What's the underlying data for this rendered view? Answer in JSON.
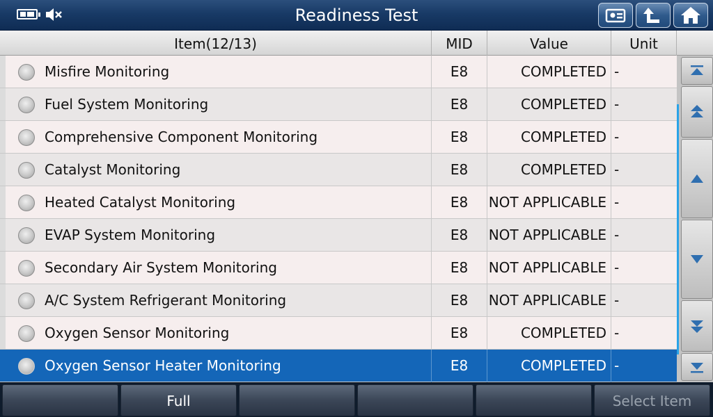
{
  "header": {
    "title": "Readiness Test",
    "status_icons": [
      "battery-icon",
      "speaker-muted-icon"
    ],
    "buttons": [
      "report-icon",
      "back-icon",
      "home-icon"
    ]
  },
  "table": {
    "columns": {
      "item": "Item(12/13)",
      "mid": "MID",
      "value": "Value",
      "unit": "Unit"
    },
    "rows": [
      {
        "item": "Misfire Monitoring",
        "mid": "E8",
        "value": "COMPLETED",
        "unit": "-"
      },
      {
        "item": "Fuel System Monitoring",
        "mid": "E8",
        "value": "COMPLETED",
        "unit": "-"
      },
      {
        "item": "Comprehensive Component Monitoring",
        "mid": "E8",
        "value": "COMPLETED",
        "unit": "-"
      },
      {
        "item": "Catalyst Monitoring",
        "mid": "E8",
        "value": "COMPLETED",
        "unit": "-"
      },
      {
        "item": "Heated Catalyst Monitoring",
        "mid": "E8",
        "value": "NOT APPLICABLE",
        "unit": "-"
      },
      {
        "item": "EVAP System Monitoring",
        "mid": "E8",
        "value": "NOT APPLICABLE",
        "unit": "-"
      },
      {
        "item": "Secondary Air System Monitoring",
        "mid": "E8",
        "value": "NOT APPLICABLE",
        "unit": "-"
      },
      {
        "item": "A/C System Refrigerant Monitoring",
        "mid": "E8",
        "value": "NOT APPLICABLE",
        "unit": "-"
      },
      {
        "item": "Oxygen Sensor Monitoring",
        "mid": "E8",
        "value": "COMPLETED",
        "unit": "-"
      },
      {
        "item": "Oxygen Sensor Heater Monitoring",
        "mid": "E8",
        "value": "COMPLETED",
        "unit": "-"
      }
    ],
    "selected_row": 9
  },
  "scroll": {
    "buttons": [
      "scroll-top-icon",
      "page-up-icon",
      "scroll-up-icon",
      "scroll-down-icon",
      "page-down-icon",
      "scroll-bottom-icon"
    ]
  },
  "footer": {
    "buttons": [
      "",
      "Full",
      "",
      "",
      "",
      "Select Item"
    ]
  },
  "colors": {
    "selected_row": "#1466b8",
    "header_bar": "#183a66",
    "scroll_indicator": "#29a3e8"
  }
}
